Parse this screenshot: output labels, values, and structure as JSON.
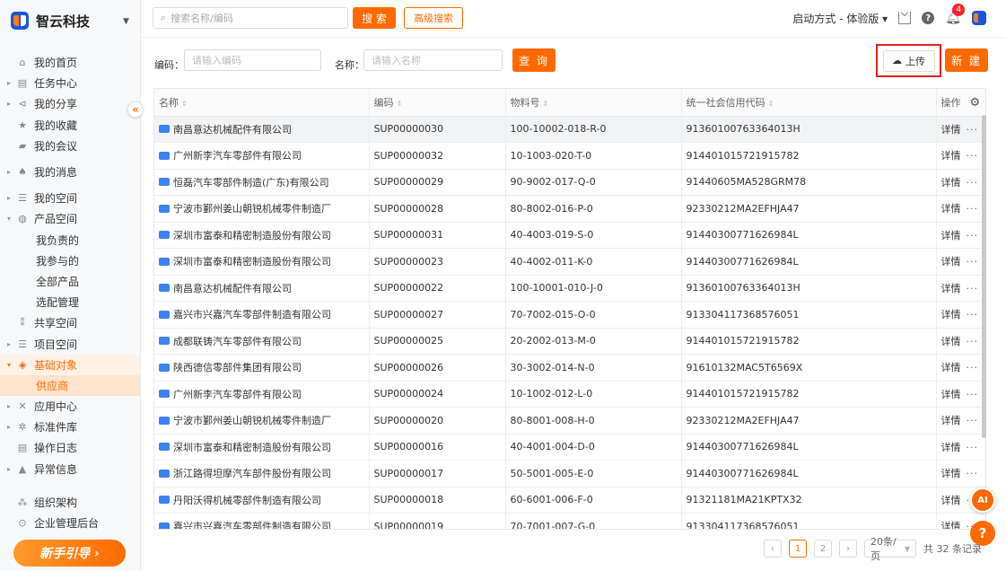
{
  "brand": {
    "name": "智云科技"
  },
  "sidebar": {
    "collapse_symbol": "«",
    "items": [
      {
        "label": "我的首页",
        "icon": "home-icon",
        "glyph": "⌂",
        "arrow": ""
      },
      {
        "label": "任务中心",
        "icon": "task-icon",
        "glyph": "▤",
        "arrow": "▸"
      },
      {
        "label": "我的分享",
        "icon": "share-icon",
        "glyph": "⊲",
        "arrow": "▸"
      },
      {
        "label": "我的收藏",
        "icon": "star-icon",
        "glyph": "★",
        "arrow": ""
      },
      {
        "label": "我的会议",
        "icon": "meeting-icon",
        "glyph": "▰",
        "arrow": ""
      },
      {
        "label": "我的消息",
        "icon": "bell-icon",
        "glyph": "♠",
        "arrow": "▸"
      },
      {
        "label": "我的空间",
        "icon": "space-icon",
        "glyph": "☰",
        "arrow": "▸"
      },
      {
        "label": "产品空间",
        "icon": "product-icon",
        "glyph": "◍",
        "arrow": "▾"
      },
      {
        "label": "我负责的",
        "sub": true
      },
      {
        "label": "我参与的",
        "sub": true
      },
      {
        "label": "全部产品",
        "sub": true
      },
      {
        "label": "选配管理",
        "sub": true
      },
      {
        "label": "共享空间",
        "icon": "shared-icon",
        "glyph": "⁑",
        "arrow": ""
      },
      {
        "label": "项目空间",
        "icon": "project-icon",
        "glyph": "☰",
        "arrow": "▸"
      },
      {
        "label": "基础对象",
        "icon": "base-object-icon",
        "glyph": "◈",
        "arrow": "▾"
      },
      {
        "label": "供应商",
        "sub": true
      },
      {
        "label": "应用中心",
        "icon": "app-icon",
        "glyph": "✕",
        "arrow": "▸"
      },
      {
        "label": "标准件库",
        "icon": "standard-icon",
        "glyph": "✲",
        "arrow": "▸"
      },
      {
        "label": "操作日志",
        "icon": "log-icon",
        "glyph": "▤",
        "arrow": ""
      },
      {
        "label": "异常信息",
        "icon": "warning-icon",
        "glyph": "▲",
        "arrow": "▸"
      },
      {
        "label": "组织架构",
        "icon": "org-icon",
        "glyph": "⁂",
        "arrow": ""
      },
      {
        "label": "企业管理后台",
        "icon": "admin-icon",
        "glyph": "⊙",
        "arrow": ""
      }
    ],
    "guide_label": "新手引导 ›"
  },
  "topbar": {
    "search_placeholder": "搜索名称/编码",
    "search_btn": "搜 索",
    "advanced_btn": "高级搜索",
    "start_mode": "启动方式 - 体验版 ▾",
    "notification_count": "4"
  },
  "filter": {
    "code_label": "编码：",
    "code_placeholder": "请输入编码",
    "name_label": "名称：",
    "name_placeholder": "请输入名称",
    "query_btn": "查 询",
    "upload_btn": "上传",
    "new_btn": "新 建"
  },
  "table": {
    "columns": [
      "名称",
      "编码",
      "物料号",
      "统一社会信用代码",
      "操作"
    ],
    "detail_label": "详情",
    "more_label": "···",
    "rows": [
      [
        "南昌意达机械配件有限公司",
        "SUP00000030",
        "100-10002-018-R-0",
        "91360100763364013H"
      ],
      [
        "广州新李汽车零部件有限公司",
        "SUP00000032",
        "10-1003-020-T-0",
        "914401015721915782"
      ],
      [
        "恒磊汽车零部件制造(广东)有限公司",
        "SUP00000029",
        "90-9002-017-Q-0",
        "91440605MA528GRM78"
      ],
      [
        "宁波市鄞州姜山朝锐机械零件制造厂",
        "SUP00000028",
        "80-8002-016-P-0",
        "92330212MA2EFHJA47"
      ],
      [
        "深圳市富泰和精密制造股份有限公司",
        "SUP00000031",
        "40-4003-019-S-0",
        "91440300771626984L"
      ],
      [
        "深圳市富泰和精密制造股份有限公司",
        "SUP00000023",
        "40-4002-011-K-0",
        "91440300771626984L"
      ],
      [
        "南昌意达机械配件有限公司",
        "SUP00000022",
        "100-10001-010-J-0",
        "91360100763364013H"
      ],
      [
        "嘉兴市兴嘉汽车零部件制造有限公司",
        "SUP00000027",
        "70-7002-015-O-0",
        "913304117368576051"
      ],
      [
        "成都联铸汽车零部件有限公司",
        "SUP00000025",
        "20-2002-013-M-0",
        "914401015721915782"
      ],
      [
        "陕西德信零部件集团有限公司",
        "SUP00000026",
        "30-3002-014-N-0",
        "91610132MAC5T6569X"
      ],
      [
        "广州新李汽车零部件有限公司",
        "SUP00000024",
        "10-1002-012-L-0",
        "914401015721915782"
      ],
      [
        "宁波市鄞州姜山朝锐机械零件制造厂",
        "SUP00000020",
        "80-8001-008-H-0",
        "92330212MA2EFHJA47"
      ],
      [
        "深圳市富泰和精密制造股份有限公司",
        "SUP00000016",
        "40-4001-004-D-0",
        "91440300771626984L"
      ],
      [
        "浙江路得坦摩汽车部件股份有限公司",
        "SUP00000017",
        "50-5001-005-E-0",
        "91440300771626984L"
      ],
      [
        "丹阳沃得机械零部件制造有限公司",
        "SUP00000018",
        "60-6001-006-F-0",
        "91321181MA21KPTX32"
      ],
      [
        "嘉兴市兴嘉汽车零部件制造有限公司",
        "SUP00000019",
        "70-7001-007-G-0",
        "913304117368576051"
      ]
    ]
  },
  "pager": {
    "prev": "‹",
    "page1": "1",
    "page2": "2",
    "next": "›",
    "size": "20条/页",
    "total": "共 32 条记录"
  },
  "float": {
    "ai": "AI",
    "help": "?"
  }
}
